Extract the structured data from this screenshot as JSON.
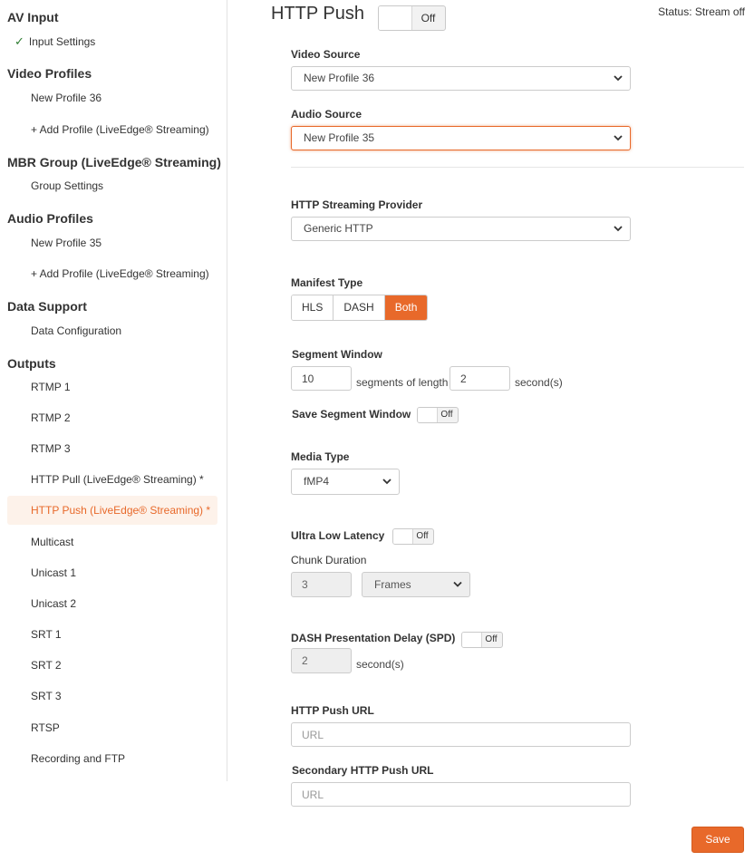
{
  "sidebar": {
    "av_input": {
      "heading": "AV Input",
      "items": [
        {
          "label": "Input Settings",
          "checked": true
        }
      ]
    },
    "video_profiles": {
      "heading": "Video Profiles",
      "items": [
        "New Profile 36",
        "+ Add Profile (LiveEdge® Streaming)"
      ]
    },
    "mbr_group": {
      "heading": "MBR Group (LiveEdge® Streaming)",
      "items": [
        "Group Settings"
      ]
    },
    "audio_profiles": {
      "heading": "Audio Profiles",
      "items": [
        "New Profile 35",
        "+ Add Profile (LiveEdge® Streaming)"
      ]
    },
    "data_support": {
      "heading": "Data Support",
      "items": [
        "Data Configuration"
      ]
    },
    "outputs": {
      "heading": "Outputs",
      "items": [
        "RTMP 1",
        "RTMP 2",
        "RTMP 3",
        "HTTP Pull (LiveEdge® Streaming) *",
        "HTTP Push (LiveEdge® Streaming) *",
        "Multicast",
        "Unicast 1",
        "Unicast 2",
        "SRT 1",
        "SRT 2",
        "SRT 3",
        "RTSP",
        "Recording and FTP"
      ],
      "active_index": 4
    }
  },
  "header": {
    "title": "HTTP Push",
    "toggle": "Off",
    "status": "Status: Stream off"
  },
  "form": {
    "video_source": {
      "label": "Video Source",
      "value": "New Profile 36"
    },
    "audio_source": {
      "label": "Audio Source",
      "value": "New Profile 35"
    },
    "provider": {
      "label": "HTTP Streaming Provider",
      "value": "Generic HTTP"
    },
    "manifest": {
      "label": "Manifest Type",
      "options": [
        "HLS",
        "DASH",
        "Both"
      ],
      "selected": "Both"
    },
    "segment_window": {
      "label": "Segment Window",
      "count": "10",
      "between": "segments of length",
      "length": "2",
      "unit": "second(s)"
    },
    "save_segment_window": {
      "label": "Save Segment Window",
      "toggle": "Off"
    },
    "media_type": {
      "label": "Media Type",
      "value": "fMP4"
    },
    "ull": {
      "label": "Ultra Low Latency",
      "toggle": "Off"
    },
    "chunk_duration": {
      "label": "Chunk Duration",
      "value": "3",
      "unit": "Frames"
    },
    "spd": {
      "label": "DASH Presentation Delay (SPD)",
      "toggle": "Off",
      "value": "2",
      "unit": "second(s)"
    },
    "push_url": {
      "label": "HTTP Push URL",
      "placeholder": "URL"
    },
    "secondary_push_url": {
      "label": "Secondary HTTP Push URL",
      "placeholder": "URL"
    }
  },
  "actions": {
    "save": "Save"
  },
  "colors": {
    "accent": "#e8692a",
    "active_bg": "#fdf2ea",
    "check": "#2e7d32"
  }
}
